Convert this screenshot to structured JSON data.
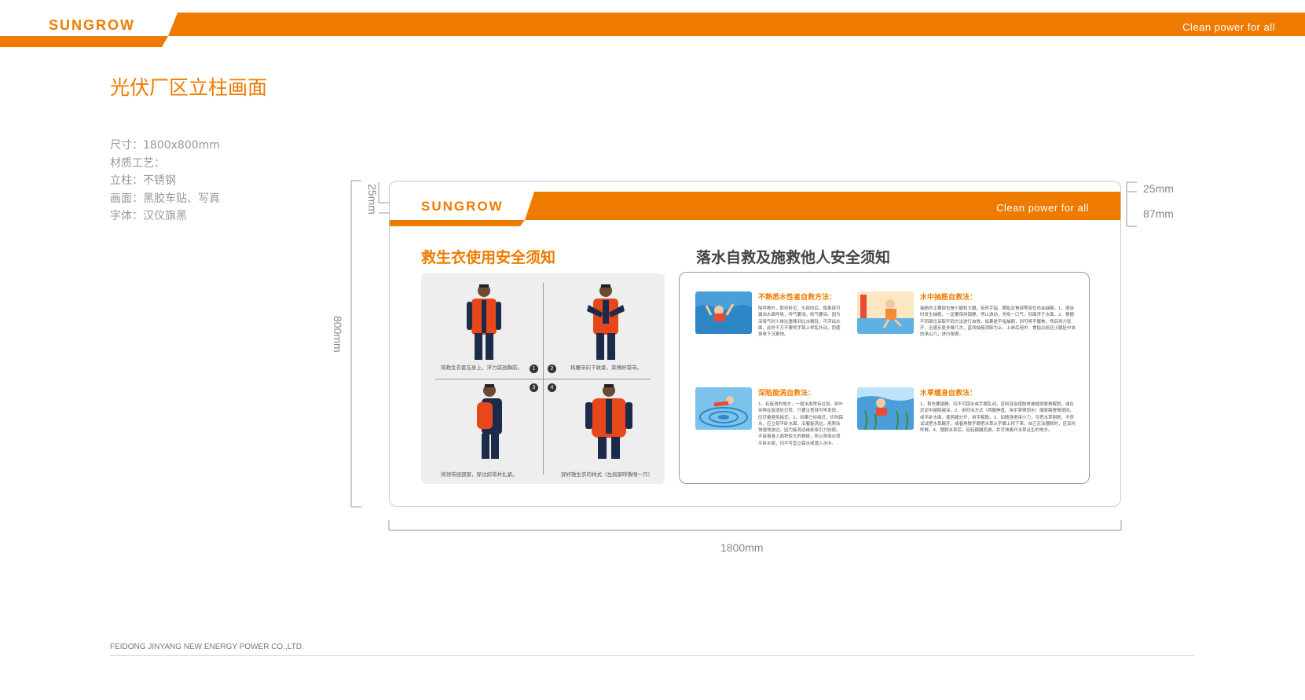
{
  "header": {
    "logo": "SUNGROW",
    "slogan": "Clean  power  for  all"
  },
  "page_title": "光伏厂区立柱画面",
  "specs": [
    "尺寸：1800x800mm",
    "材质工艺：",
    "立柱：不锈钢",
    "画面：黑胶车贴、写真",
    "字体：汉仪旗黑"
  ],
  "dimensions": {
    "band_top_left": "25mm",
    "band_top_right": "25mm",
    "band_height": "87mm",
    "height": "800mm",
    "width": "1800mm"
  },
  "board": {
    "logo": "SUNGROW",
    "slogan": "Clean  power  for  all",
    "left_title": "救生衣使用安全须知",
    "right_title": "落水自救及施救他人安全须知",
    "steps": [
      {
        "num": "1",
        "caption": "将救生衣套在身上，浮力袋放胸前。"
      },
      {
        "num": "2",
        "caption": "将腰带向下收紧，束缚好袋带。"
      },
      {
        "num": "3",
        "caption": "将领带绕颈部，穿过扣带并扎紧。"
      },
      {
        "num": "4",
        "caption": "穿好救生衣的样式（左肩部呼救哨一只）"
      }
    ],
    "tips": [
      {
        "title": "不熟悉水性者自救方法：",
        "body": "除呼救外，取仰卧位，头部向后，使鼻部可露出水面呼吸，呼气要浅，吸气要深。因为深吸气时人体比重降到比水略轻，可浮出水面，此时千万不要将手臂上举乱扑动，而使身体下沉更快。"
      },
      {
        "title": "水中抽筋自救法：",
        "body": "抽筋的主要部位是小腿和大腿，有时手指、脚趾及胃部等部位也会抽筋。1、游泳时发生抽筋，一定要保持镇静，停止游动，先吸一口气，仰面浮于水面。2、根据不同部位采取不同方法进行自救。如果是手指抽筋，则可将手握拳，然后用力张开，迅速反复多做几次，直到抽筋消除为止。上岸后用中、食指尖掐压小腿肚中央的承山穴，进行按摩。"
      },
      {
        "title": "深陷旋涡自救法：",
        "body": "1、有旋涡的地方，一般水面常有垃圾、树叶杂物在旋涡处打转，只要注意就可早发现，应尽量避免接近。2、如果已经接近，切勿踩水，应立刻平卧水面，沿着旋涡边，用爬泳快速地游过。因为旋涡边缘处吸引力较弱，不容易卷入面积较大的物体，所以身体必须平卧水面，切不可直立踩水或潜入水中。"
      },
      {
        "title": "水草缠身自救法：",
        "body": "1、首先要镇静，切不可踩水或手脚乱动，否则就会使肢体被缠得更难解脱，或在淤泥中越陷越深。2、用仰泳方式（两腿伸直、用手掌倒划水）顺原路慢慢退回，或平卧水面，使两腿分开，用手解脱。3、如随身携带小刀，可把水草割断，不然试试把水草踢开，或者挣脱手脚把水草从手脚上捋下来。自己无法摆脱时，应及时呼救。4、摆脱水草后，轻轻踢腿而游，并尽快离开水草丛生的地方。"
      }
    ]
  },
  "footer": "FEIDONG JINYANG NEW ENERGY POWER CO.,LTD.",
  "colors": {
    "brand_orange": "#ee7b00",
    "vest_orange": "#e8471c",
    "navy": "#1d2b4a",
    "water_blue": "#4a9fd8"
  }
}
